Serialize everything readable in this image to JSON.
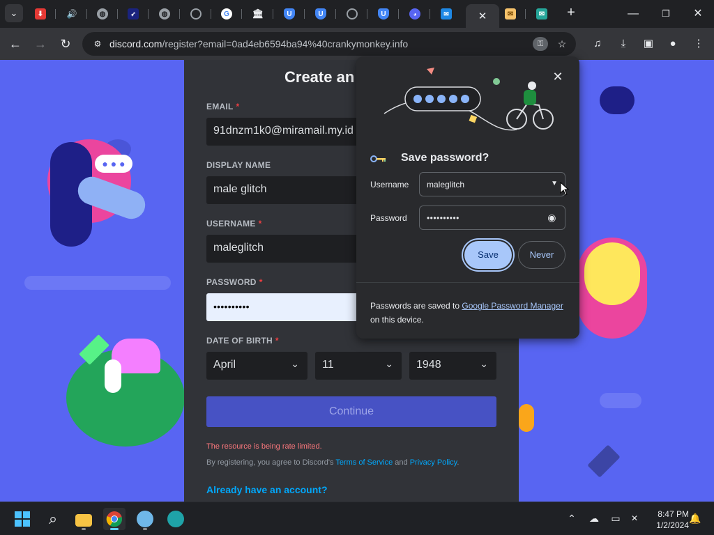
{
  "browser": {
    "tabs": [
      {
        "icon": "download-arrow-icon",
        "color": "#e53935"
      },
      {
        "icon": "speaker-icon",
        "color": "#202124"
      },
      {
        "icon": "globe-icon",
        "color": "#9aa0a6"
      },
      {
        "icon": "wing-logo-icon",
        "color": "#1a237e"
      },
      {
        "icon": "globe-icon",
        "color": "#9aa0a6"
      },
      {
        "icon": "chrome-icon",
        "color": "#9aa0a6"
      },
      {
        "icon": "google-g-icon",
        "color": "#ffffff"
      },
      {
        "icon": "bank-icon",
        "color": "#e8eaed"
      },
      {
        "icon": "shield-u-icon",
        "color": "#4285f4"
      },
      {
        "icon": "shield-u-icon",
        "color": "#4285f4"
      },
      {
        "icon": "chrome-icon",
        "color": "#9aa0a6"
      },
      {
        "icon": "shield-u-icon",
        "color": "#4285f4"
      },
      {
        "icon": "discord-icon",
        "color": "#5865f2"
      },
      {
        "icon": "mail-box-icon",
        "color": "#1e88e5"
      },
      {
        "icon": "close-icon",
        "active": true
      },
      {
        "icon": "envelope-open-icon",
        "color": "#f6c26b"
      },
      {
        "icon": "mail-icon",
        "color": "#26a69a"
      }
    ],
    "url_host": "discord.com",
    "url_path": "/register?email=0ad4eb6594ba94%40crankymonkey.info"
  },
  "form": {
    "title": "Create an",
    "email": {
      "label": "EMAIL",
      "required": "*",
      "value": "91dnzm1k0@miramail.my.id"
    },
    "display_name": {
      "label": "DISPLAY NAME",
      "value": "male glitch"
    },
    "username": {
      "label": "USERNAME",
      "required": "*",
      "value": "maleglitch"
    },
    "password": {
      "label": "PASSWORD",
      "required": "*",
      "value": "••••••••••"
    },
    "dob": {
      "label": "DATE OF BIRTH",
      "required": "*",
      "month": "April",
      "day": "11",
      "year": "1948"
    },
    "continue_label": "Continue",
    "error": "The resource is being rate limited.",
    "legal": {
      "prefix": "By registering, you agree to Discord's ",
      "tos": "Terms of Service",
      "and": " and ",
      "privacy": "Privacy Policy",
      "suffix": "."
    },
    "login_link": "Already have an account?"
  },
  "save_password": {
    "title": "Save password?",
    "username_label": "Username",
    "username_value": "maleglitch",
    "password_label": "Password",
    "password_value": "••••••••••",
    "save_label": "Save",
    "never_label": "Never",
    "footer_prefix": "Passwords are saved to ",
    "footer_link": "Google Password Manager",
    "footer_suffix": "on this device."
  },
  "taskbar": {
    "time": "8:47 PM",
    "date": "1/2/2024"
  },
  "colors": {
    "discord_blurple": "#5865f2",
    "card_bg": "#313338",
    "link": "#00a8fc",
    "error": "#fa777c",
    "save_button": "#a8c7fa"
  }
}
